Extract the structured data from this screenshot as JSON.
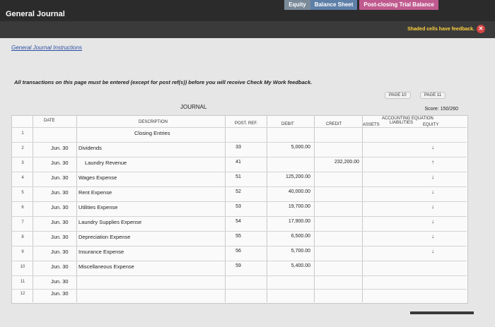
{
  "header": {
    "title": "General Journal",
    "tabs": [
      "Equity",
      "Balance Sheet",
      "Post-closing Trial Balance"
    ]
  },
  "feedback": {
    "label": "Shaded cells have feedback.",
    "icon": "close-icon"
  },
  "instructions": {
    "link": "General Journal Instructions",
    "text": "All transactions on this page must be entered (except for post ref(s)) before you will receive Check My Work feedback."
  },
  "pages": [
    "PAGE 10",
    "PAGE 11"
  ],
  "score": "Score: 150/260",
  "journal": {
    "title": "JOURNAL",
    "headers": {
      "date": "DATE",
      "description": "DESCRIPTION",
      "post_ref": "POST. REF.",
      "debit": "DEBIT",
      "credit": "CREDIT",
      "equation": "ACCOUNTING EQUATION",
      "assets": "ASSETS",
      "liabilities": "LIABILITIES",
      "equity": "EQUITY"
    },
    "rows": [
      {
        "num": "1",
        "date": "",
        "desc": "Closing Entries",
        "post": "",
        "debit": "",
        "credit": "",
        "eq": ""
      },
      {
        "num": "2",
        "date": "Jun. 30",
        "desc": "Dividends",
        "post": "33",
        "debit": "5,000.00",
        "credit": "",
        "eq": "↓"
      },
      {
        "num": "3",
        "date": "Jun. 30",
        "desc": "Laundry Revenue",
        "post": "41",
        "debit": "",
        "credit": "232,200.00",
        "eq": "↑"
      },
      {
        "num": "4",
        "date": "Jun. 30",
        "desc": "Wages Expense",
        "post": "51",
        "debit": "125,200.00",
        "credit": "",
        "eq": "↓"
      },
      {
        "num": "5",
        "date": "Jun. 30",
        "desc": "Rent Expense",
        "post": "52",
        "debit": "40,000.00",
        "credit": "",
        "eq": "↓"
      },
      {
        "num": "6",
        "date": "Jun. 30",
        "desc": "Utilities Expense",
        "post": "53",
        "debit": "19,700.00",
        "credit": "",
        "eq": "↓"
      },
      {
        "num": "7",
        "date": "Jun. 30",
        "desc": "Laundry Supplies Expense",
        "post": "54",
        "debit": "17,900.00",
        "credit": "",
        "eq": "↓"
      },
      {
        "num": "8",
        "date": "Jun. 30",
        "desc": "Depreciation Expense",
        "post": "55",
        "debit": "6,500.00",
        "credit": "",
        "eq": "↓"
      },
      {
        "num": "9",
        "date": "Jun. 30",
        "desc": "Insurance Expense",
        "post": "56",
        "debit": "5,700.00",
        "credit": "",
        "eq": "↓"
      },
      {
        "num": "10",
        "date": "Jun. 30",
        "desc": "Miscellaneous Expense",
        "post": "59",
        "debit": "5,400.00",
        "credit": "",
        "eq": ""
      },
      {
        "num": "11",
        "date": "Jun. 30",
        "desc": "",
        "post": "",
        "debit": "",
        "credit": "",
        "eq": ""
      },
      {
        "num": "12",
        "date": "Jun. 30",
        "desc": "",
        "post": "",
        "debit": "",
        "credit": "",
        "eq": ""
      }
    ]
  }
}
